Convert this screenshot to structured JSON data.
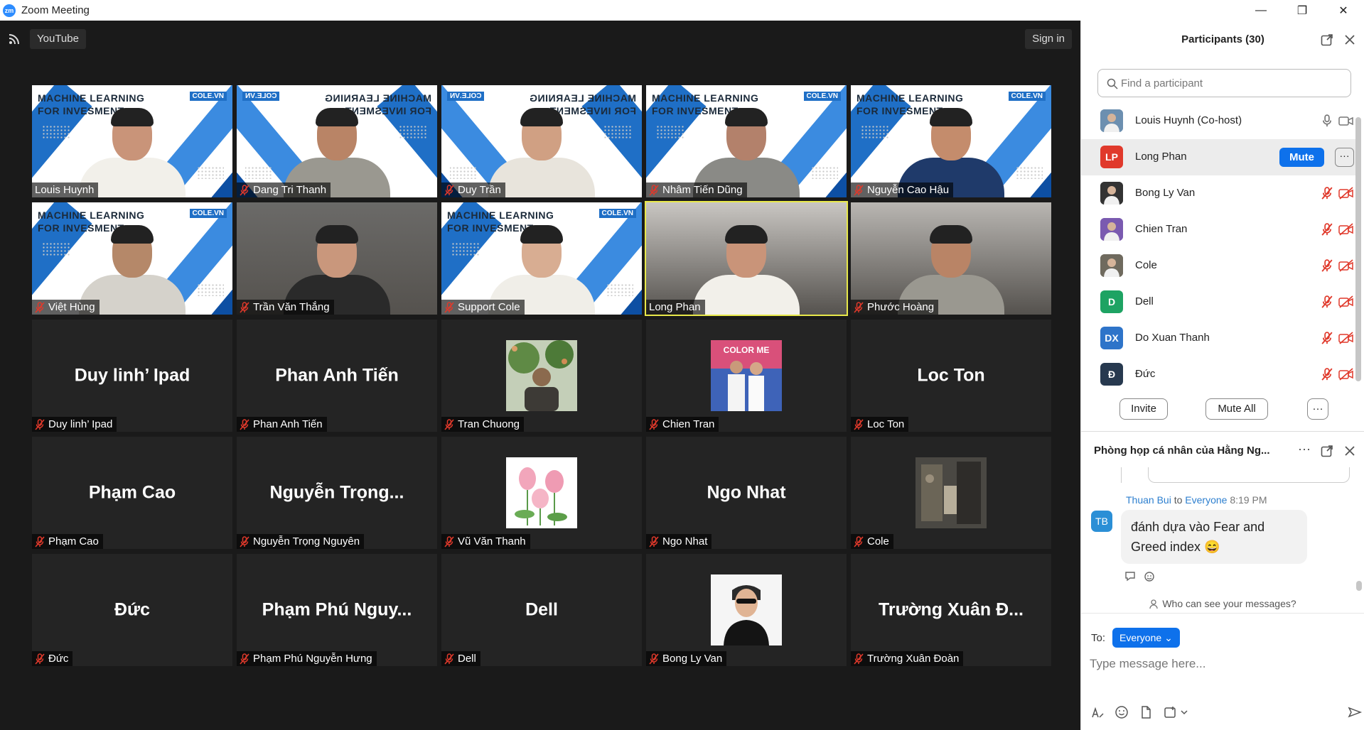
{
  "window": {
    "title": "Zoom Meeting",
    "logo_text": "zm",
    "minimize": "—",
    "restore": "❐",
    "close": "✕"
  },
  "topbar": {
    "stream_label": "YouTube",
    "signin_label": "Sign in"
  },
  "banner": {
    "line1": "MACHINE LEARNING",
    "line2": "FOR INVESMENT",
    "brand": "COLE.VN"
  },
  "tiles": [
    {
      "type": "video",
      "label": "Louis Huynh",
      "muted": false,
      "banner": true,
      "mirror": false
    },
    {
      "type": "video",
      "label": "Dang Tri Thanh",
      "muted": true,
      "banner": true,
      "mirror": true
    },
    {
      "type": "video",
      "label": "Duy Trần",
      "muted": true,
      "banner": true,
      "mirror": true
    },
    {
      "type": "video",
      "label": "Nhâm Tiến Dũng",
      "muted": true,
      "banner": true,
      "mirror": false
    },
    {
      "type": "video",
      "label": "Nguyễn Cao Hậu",
      "muted": true,
      "banner": true,
      "mirror": false
    },
    {
      "type": "video",
      "label": "Việt Hùng",
      "muted": true,
      "banner": true,
      "mirror": false
    },
    {
      "type": "video",
      "label": "Trần Văn Thắng",
      "muted": true,
      "banner": false,
      "room": "#6b6a68"
    },
    {
      "type": "video",
      "label": "Support Cole",
      "muted": true,
      "banner": true,
      "mirror": false
    },
    {
      "type": "video",
      "label": "Long Phan",
      "muted": false,
      "banner": false,
      "room": "#c9c6c2",
      "active": true
    },
    {
      "type": "video",
      "label": "Phước Hoàng",
      "muted": true,
      "banner": false,
      "room": "#b9b6b2"
    },
    {
      "type": "name",
      "big": "Duy linh’ Ipad",
      "label": "Duy linh’ Ipad",
      "muted": true
    },
    {
      "type": "name",
      "big": "Phan Anh Tiến",
      "label": "Phan Anh Tiến",
      "muted": true
    },
    {
      "type": "avatar",
      "label": "Tran Chuong",
      "muted": true,
      "img": "tree"
    },
    {
      "type": "avatar",
      "label": "Chien Tran",
      "muted": true,
      "img": "colorme",
      "img_text": "COLOR ME"
    },
    {
      "type": "name",
      "big": "Loc Ton",
      "label": "Loc Ton",
      "muted": true
    },
    {
      "type": "name",
      "big": "Phạm Cao",
      "label": "Phạm Cao",
      "muted": true
    },
    {
      "type": "name",
      "big": "Nguyễn Trọng...",
      "label": "Nguyễn Trọng Nguyên",
      "muted": true
    },
    {
      "type": "avatar",
      "label": "Vũ Văn Thanh",
      "muted": true,
      "img": "lotus"
    },
    {
      "type": "name",
      "big": "Ngo Nhat",
      "label": "Ngo Nhat",
      "muted": true
    },
    {
      "type": "avatar",
      "label": "Cole",
      "muted": true,
      "img": "street"
    },
    {
      "type": "name",
      "big": "Đức",
      "label": "Đức",
      "muted": true
    },
    {
      "type": "name",
      "big": "Phạm Phú Nguy...",
      "label": "Phạm Phú Nguyễn Hưng",
      "muted": true
    },
    {
      "type": "name",
      "big": "Dell",
      "label": "Dell",
      "muted": true
    },
    {
      "type": "avatar",
      "label": "Bong Ly Van",
      "muted": true,
      "img": "man"
    },
    {
      "type": "name",
      "big": "Trường Xuân Đ...",
      "label": "Trường Xuân Đoàn",
      "muted": true
    }
  ],
  "participants": {
    "title": "Participants (30)",
    "search_placeholder": "Find a participant",
    "list": [
      {
        "name": "Louis Huynh (Co-host)",
        "avatar": "photo",
        "color": "#6c8fb0",
        "state": "on"
      },
      {
        "name": "Long Phan",
        "avatar_text": "LP",
        "color": "#e0392b",
        "state": "hover"
      },
      {
        "name": "Bong Ly Van",
        "avatar": "photo",
        "color": "#333333",
        "state": "muted"
      },
      {
        "name": "Chien Tran",
        "avatar": "photo",
        "color": "#7a5ab0",
        "state": "muted"
      },
      {
        "name": "Cole",
        "avatar": "photo",
        "color": "#6f6a5e",
        "state": "muted"
      },
      {
        "name": "Dell",
        "avatar_text": "D",
        "color": "#1ea363",
        "state": "muted"
      },
      {
        "name": "Do Xuan Thanh",
        "avatar_text": "DX",
        "color": "#2e74c9",
        "state": "muted"
      },
      {
        "name": "Đức",
        "avatar_text": "Đ",
        "color": "#27394f",
        "state": "muted"
      }
    ],
    "mute_label": "Mute",
    "more_label": "···",
    "invite_label": "Invite",
    "mute_all_label": "Mute All",
    "options_label": "···"
  },
  "chat": {
    "title": "Phòng họp cá nhân của Hằng Ng...",
    "header_more": "···",
    "message": {
      "sender": "Thuan Bui",
      "to_word": " to ",
      "recipient": "Everyone",
      "time": "8:19 PM",
      "initials": "TB",
      "text": "đánh dựa vào Fear and Greed index 😄"
    },
    "who_can_see": "Who can see your messages?",
    "to_label": "To:",
    "to_value": "Everyone",
    "input_placeholder": "Type message here..."
  },
  "colors": {
    "accent": "#0e71eb",
    "muted_icon": "#e0392b",
    "active_speaker": "#e8e84a"
  }
}
